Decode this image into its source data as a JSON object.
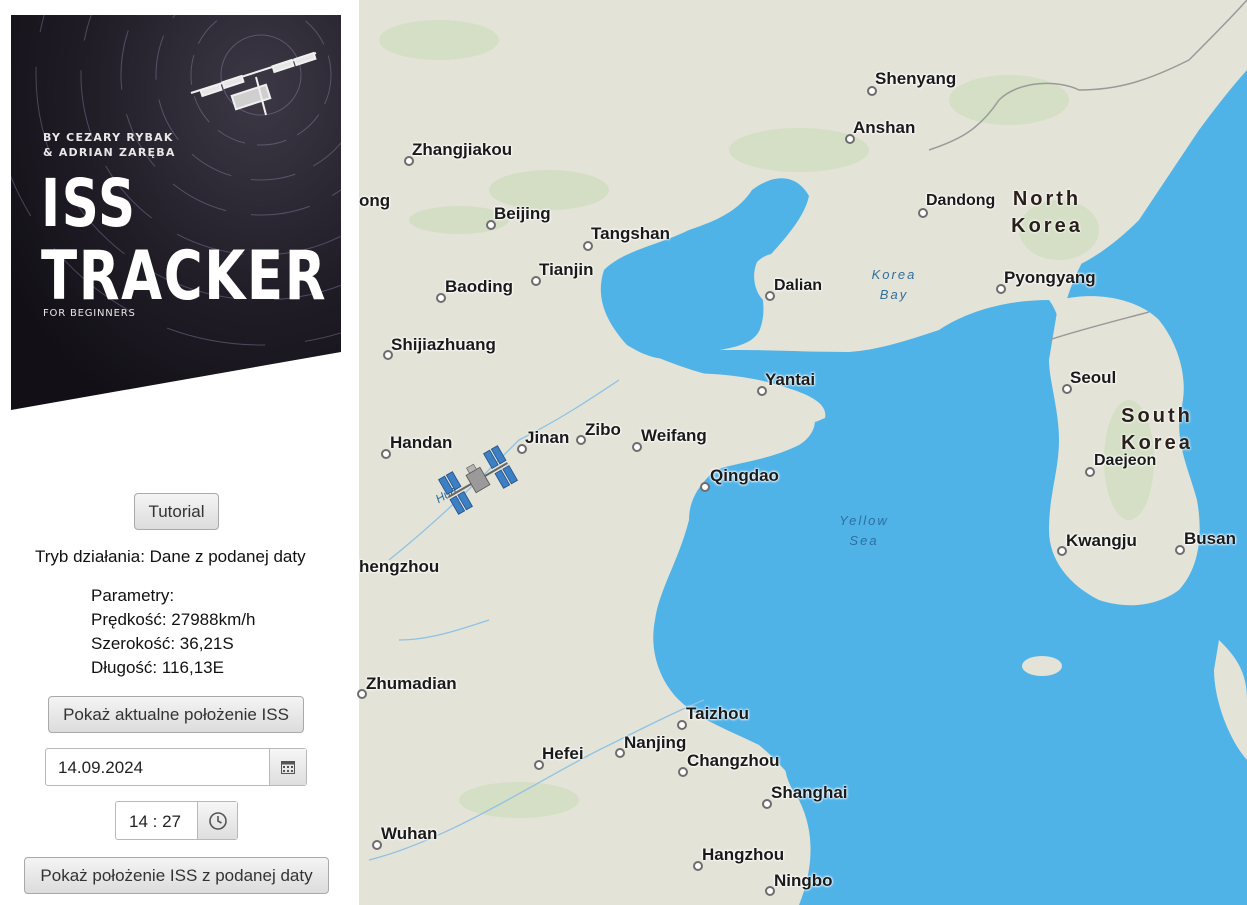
{
  "cover": {
    "byline_1": "BY CEZARY RYBAK",
    "byline_2": "& ADRIAN ZARĘBA",
    "title_1": "ISS",
    "title_2": "TRACKER",
    "subtitle": "FOR BEGINNERS"
  },
  "controls": {
    "tutorial_label": "Tutorial",
    "mode_text": "Tryb działania: Dane z podanej daty",
    "params_heading": "Parametry:",
    "speed_text": "Prędkość: 27988km/h",
    "latitude_text": "Szerokość: 36,21S",
    "longitude_text": "Długość: 116,13E",
    "show_current_label": "Pokaż aktualne położenie ISS",
    "date_value": "14.09.2024",
    "time_value": "14 : 27",
    "show_date_label": "Pokaż położenie ISS z podanej daty"
  },
  "map": {
    "cities": [
      "Shenyang",
      "Anshan",
      "Zhangjiakou",
      "ong",
      "Beijing",
      "Tangshan",
      "Dandong",
      "Tianjin",
      "Baoding",
      "Dalian",
      "Pyongyang",
      "Shijiazhuang",
      "Yantai",
      "Seoul",
      "Handan",
      "Jinan",
      "Zibo",
      "Weifang",
      "Daejeon",
      "Qingdao",
      "Kwangju",
      "Busan",
      "hengzhou",
      "Zhumadian",
      "Taizhou",
      "Nanjing",
      "Hefei",
      "Changzhou",
      "Shanghai",
      "Wuhan",
      "Hangzhou",
      "Ningbo"
    ],
    "countries": {
      "north_korea_1": "North",
      "north_korea_2": "Korea",
      "south_korea_1": "South",
      "south_korea_2": "Korea"
    },
    "seas": {
      "korea_bay_1": "Korea",
      "korea_bay_2": "Bay",
      "yellow_sea_1": "Yellow",
      "yellow_sea_2": "Sea"
    },
    "river_label": "Hua"
  },
  "colors": {
    "water": "#4fb3e8",
    "land": "#e4e3d8",
    "accent": "#2c7fb8"
  }
}
